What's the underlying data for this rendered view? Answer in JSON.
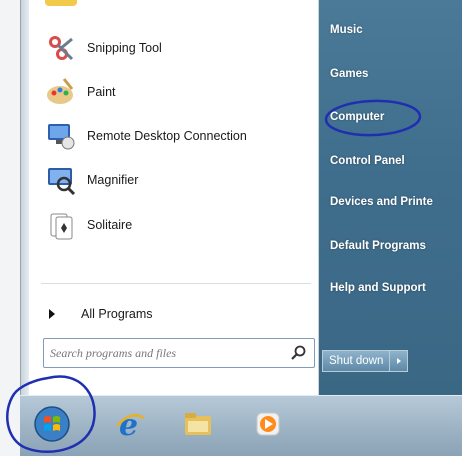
{
  "start_menu": {
    "programs": [
      {
        "label": "Snipping Tool",
        "icon": "scissors-icon"
      },
      {
        "label": "Paint",
        "icon": "paint-palette-icon"
      },
      {
        "label": "Remote Desktop Connection",
        "icon": "remote-desktop-icon"
      },
      {
        "label": "Magnifier",
        "icon": "magnifier-icon"
      },
      {
        "label": "Solitaire",
        "icon": "solitaire-cards-icon"
      }
    ],
    "all_programs": "All Programs",
    "search_placeholder": "Search programs and files",
    "right_pane": [
      {
        "label": "Music"
      },
      {
        "label": "Games"
      },
      {
        "label": "Computer"
      },
      {
        "label": "Control Panel"
      },
      {
        "label": "Devices and Printe"
      },
      {
        "label": "Default Programs"
      },
      {
        "label": "Help and Support"
      }
    ],
    "shutdown_label": "Shut down"
  },
  "taskbar": {
    "items": [
      {
        "icon": "windows-start-orb-icon"
      },
      {
        "icon": "internet-explorer-icon"
      },
      {
        "icon": "file-explorer-folder-icon"
      },
      {
        "icon": "media-player-icon"
      }
    ]
  },
  "annotations": {
    "highlighted": [
      "Computer",
      "Start button"
    ],
    "color": "#1f2fb0"
  }
}
